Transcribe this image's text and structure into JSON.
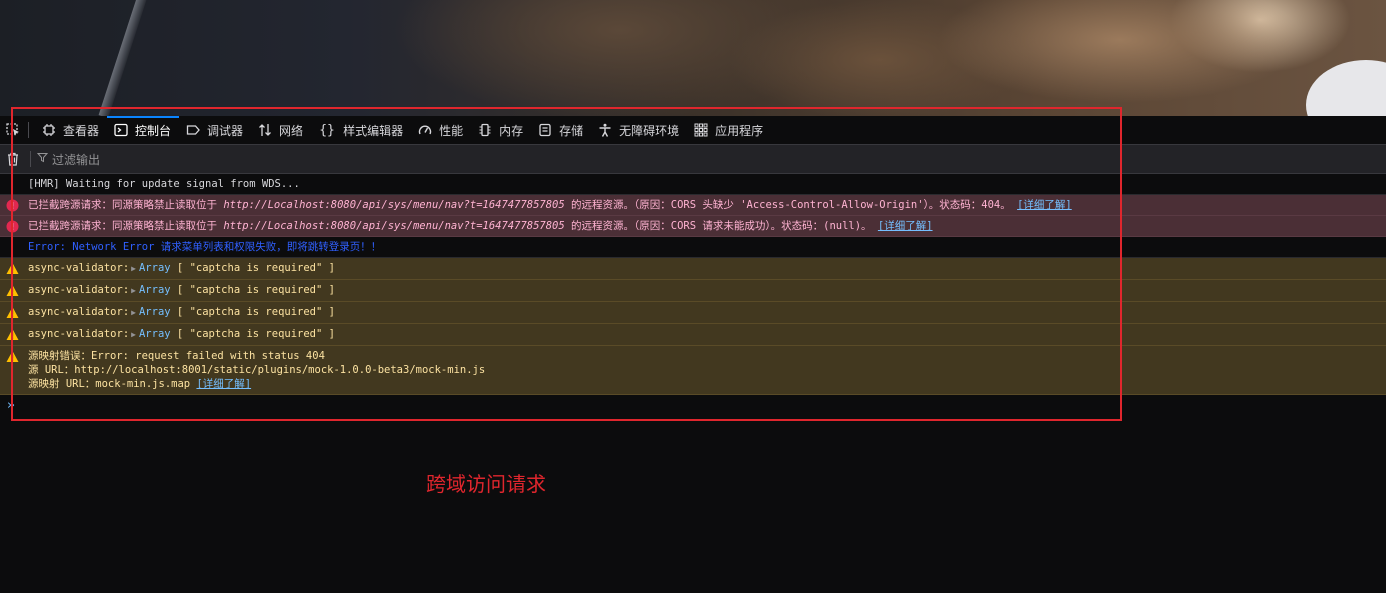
{
  "toolbar": {
    "tabs": [
      {
        "label": "查看器",
        "icon": "inspector-icon"
      },
      {
        "label": "控制台",
        "icon": "console-icon",
        "active": true
      },
      {
        "label": "调试器",
        "icon": "debugger-icon"
      },
      {
        "label": "网络",
        "icon": "network-icon"
      },
      {
        "label": "样式编辑器",
        "icon": "style-editor-icon"
      },
      {
        "label": "性能",
        "icon": "performance-icon"
      },
      {
        "label": "内存",
        "icon": "memory-icon"
      },
      {
        "label": "存储",
        "icon": "storage-icon"
      },
      {
        "label": "无障碍环境",
        "icon": "accessibility-icon"
      },
      {
        "label": "应用程序",
        "icon": "application-icon"
      }
    ]
  },
  "filterbar": {
    "placeholder": "过滤输出"
  },
  "console": {
    "hmr": "[HMR] Waiting for update signal from WDS...",
    "error1": {
      "prefix": "已拦截跨源请求：同源策略禁止读取位于 ",
      "url": "http://Localhost:8080/api/sys/menu/nav?t=1647477857805",
      "suffix": " 的远程资源。（原因：CORS 头缺少 'Access-Control-Allow-Origin'）。状态码：404。",
      "link": "[详细了解]"
    },
    "error2": {
      "prefix": "已拦截跨源请求：同源策略禁止读取位于 ",
      "url": "http://Localhost:8080/api/sys/menu/nav?t=1647477857805",
      "suffix": " 的远程资源。（原因：CORS 请求未能成功）。状态码：(null)。",
      "link": "[详细了解]"
    },
    "network_error": "Error: Network Error 请求菜单列表和权限失败，即将跳转登录页！！",
    "warnings": [
      {
        "source": "async-validator:",
        "type": "Array",
        "value": "\"captcha is required\""
      },
      {
        "source": "async-validator:",
        "type": "Array",
        "value": "\"captcha is required\""
      },
      {
        "source": "async-validator:",
        "type": "Array",
        "value": "\"captcha is required\""
      },
      {
        "source": "async-validator:",
        "type": "Array",
        "value": "\"captcha is required\""
      }
    ],
    "sourcemap": {
      "line1": "源映射错误：Error: request failed with status 404",
      "line2": "源 URL：http://localhost:8001/static/plugins/mock-1.0.0-beta3/mock-min.js",
      "line3": "源映射 URL：mock-min.js.map ",
      "link": "[详细了解]"
    }
  },
  "annotation": {
    "caption": "跨域访问请求",
    "color": "#e0262d"
  }
}
